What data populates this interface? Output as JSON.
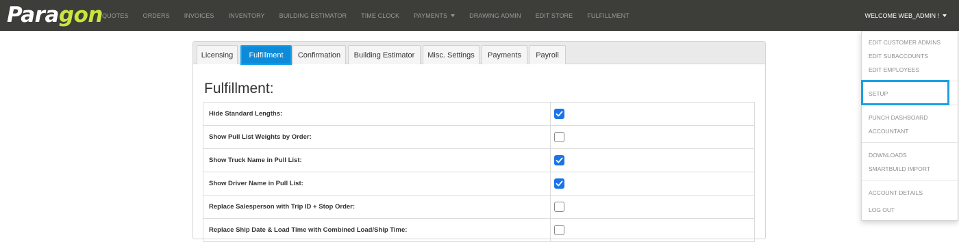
{
  "brand": {
    "part1": "Para",
    "part2": "gon",
    "part3": "n",
    "accent": "#c8e63c"
  },
  "nav": {
    "items": [
      "QUOTES",
      "ORDERS",
      "INVOICES",
      "INVENTORY",
      "BUILDING ESTIMATOR",
      "TIME CLOCK",
      "PAYMENTS",
      "DRAWING ADMIN",
      "EDIT STORE",
      "FULFILLMENT"
    ],
    "welcome": "WELCOME WEB_ADMIN !"
  },
  "tabs": [
    "Licensing",
    "Fulfillment",
    "Confirmation",
    "Building Estimator",
    "Misc. Settings",
    "Payments",
    "Payroll"
  ],
  "active_tab": "Fulfillment",
  "page": {
    "title": "Fulfillment:"
  },
  "settings": [
    {
      "label": "Hide Standard Lengths:",
      "checked": true
    },
    {
      "label": "Show Pull List Weights by Order:",
      "checked": false
    },
    {
      "label": "Show Truck Name in Pull List:",
      "checked": true
    },
    {
      "label": "Show Driver Name in Pull List:",
      "checked": true
    },
    {
      "label": "Replace Salesperson with Trip ID + Stop Order:",
      "checked": false
    },
    {
      "label": "Replace Ship Date & Load Time with Combined Load/Ship Time:",
      "checked": false
    }
  ],
  "user_menu": {
    "groups": [
      [
        "EDIT CUSTOMER ADMINS",
        "EDIT SUBACCOUNTS",
        "EDIT EMPLOYEES"
      ],
      [
        "SETUP"
      ],
      [
        "PUNCH DASHBOARD",
        "ACCOUNTANT"
      ],
      [
        "DOWNLOADS",
        "SMARTBUILD IMPORT"
      ],
      [
        "ACCOUNT DETAILS",
        "LOG OUT"
      ]
    ],
    "highlighted": "SETUP"
  },
  "colors": {
    "navbar": "#3d3d3a",
    "active_tab": "#0d8bd9",
    "checkbox_on": "#1a73e8",
    "highlight": "#1ba1e2"
  }
}
